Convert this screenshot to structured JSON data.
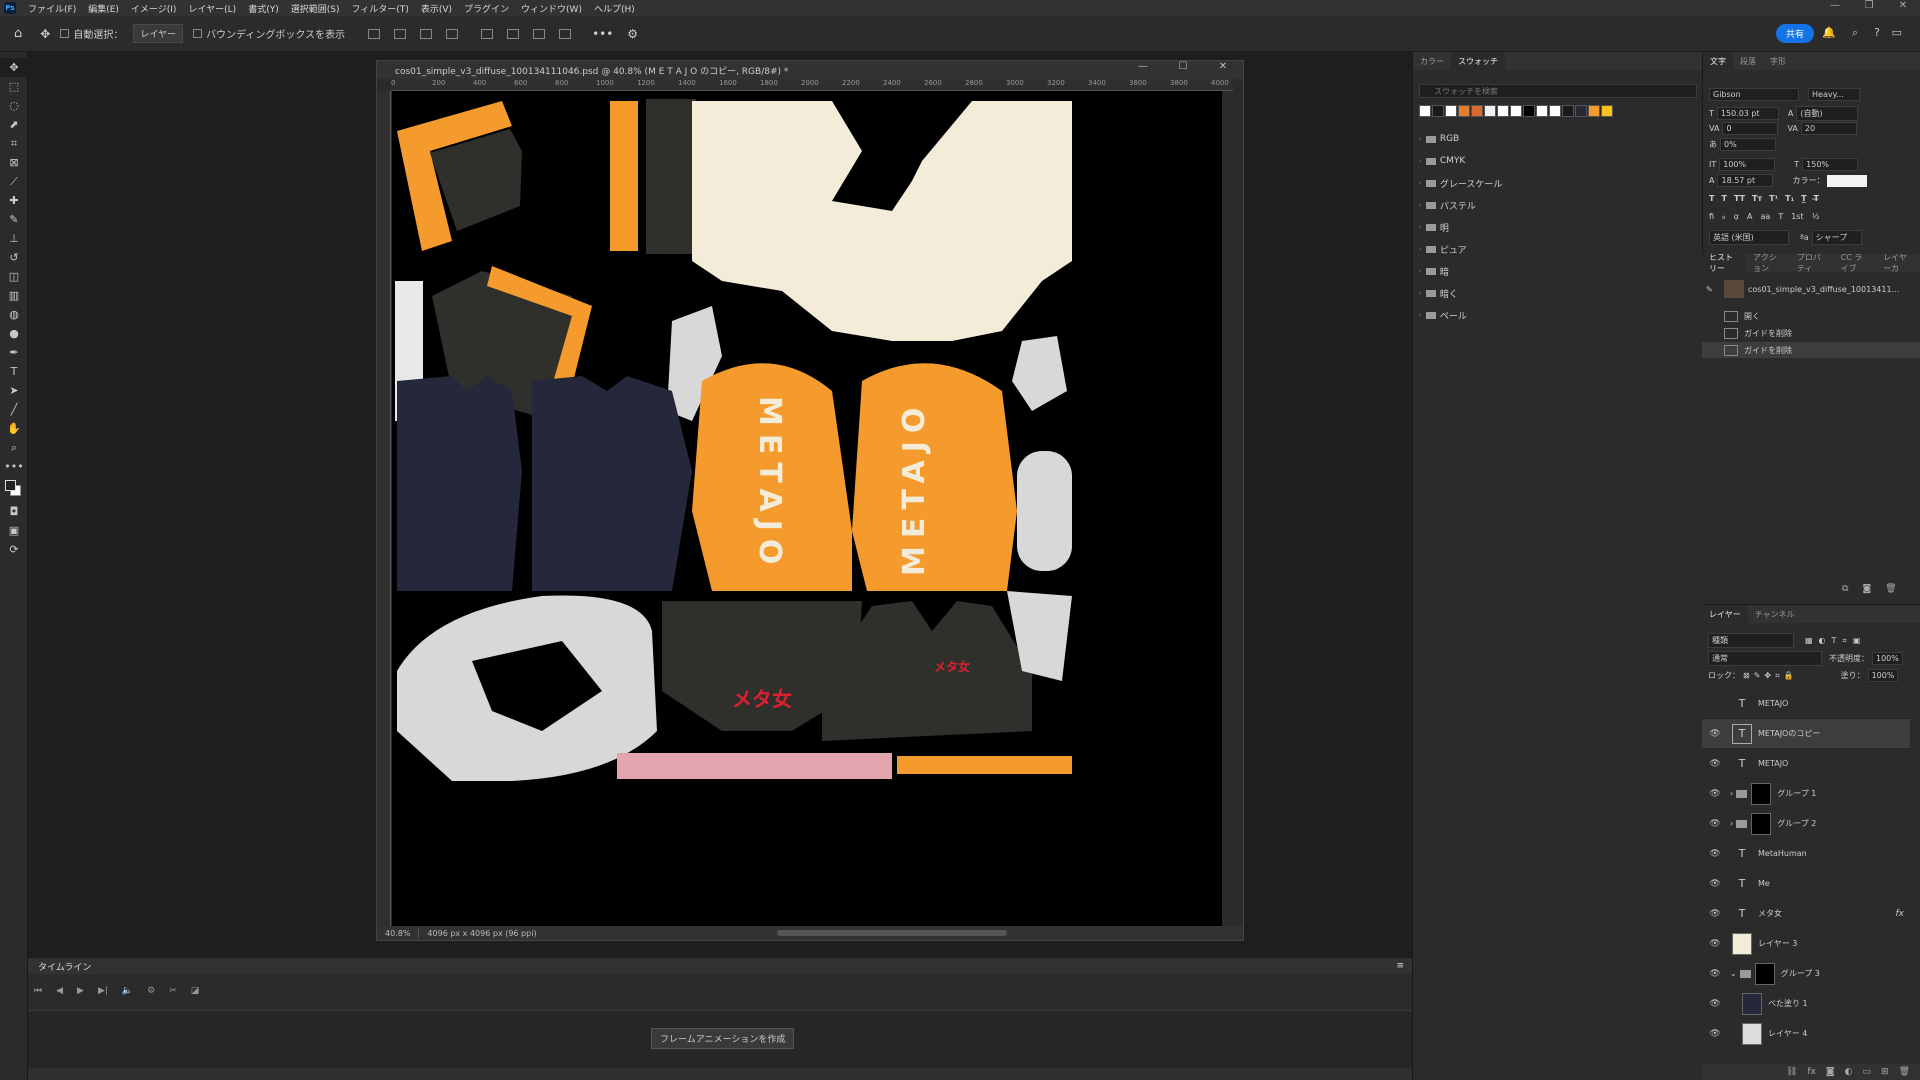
{
  "menubar": {
    "items": [
      "ファイル(F)",
      "編集(E)",
      "イメージ(I)",
      "レイヤー(L)",
      "書式(Y)",
      "選択範囲(S)",
      "フィルター(T)",
      "表示(V)",
      "プラグイン",
      "ウィンドウ(W)",
      "ヘルプ(H)"
    ]
  },
  "options": {
    "auto_select": "自動選択：",
    "auto_select_target": "レイヤー",
    "bounding_box": "バウンディングボックスを表示",
    "share": "共有"
  },
  "document": {
    "title": "cos01_simple_v3_diffuse_100134111046.psd @ 40.8% (M E T A J O のコピー, RGB/8#) *",
    "zoom": "40.8%",
    "dimensions": "4096 px x 4096 px (96 ppi)",
    "ruler_ticks": [
      "0",
      "200",
      "400",
      "600",
      "800",
      "1000",
      "1200",
      "1400",
      "1600",
      "1800",
      "2000",
      "2200",
      "2400",
      "2600",
      "2800",
      "3000",
      "3200",
      "3400",
      "3600",
      "3800",
      "4000"
    ],
    "canvas_texts": {
      "metajo_1": "METAJO",
      "metajo_2": "METAJO",
      "logo_1": "メタ女",
      "logo_2": "メタ女"
    }
  },
  "timeline": {
    "tab": "タイムライン",
    "create_button": "フレームアニメーションを作成"
  },
  "swatches_panel": {
    "tabs": [
      "カラー",
      "スウォッチ"
    ],
    "active_tab": "スウォッチ",
    "search_placeholder": "スウォッチを検索",
    "colors": [
      "#ffffff",
      "#1a1a1a",
      "#ffffff",
      "#e37b2d",
      "#d96a2b",
      "#f0f0f0",
      "#ffffff",
      "#ffffff",
      "#000000",
      "#ffffff",
      "#ffffff",
      "#1a1a1a",
      "#2a2a35",
      "#f59a2d",
      "#ffc21a"
    ],
    "folders": [
      "RGB",
      "CMYK",
      "グレースケール",
      "パステル",
      "明",
      "ピュア",
      "暗",
      "暗く",
      "ペール"
    ]
  },
  "character_panel": {
    "tabs": [
      "文字",
      "段落",
      "字形"
    ],
    "active_tab": "文字",
    "font": "Gibson",
    "style": "Heavy...",
    "size": "150.03 pt",
    "leading": "(自動)",
    "kerning": "0",
    "tracking": "20",
    "scale_pct": "0%",
    "vscale": "100%",
    "hscale": "150%",
    "baseline": "18.57 pt",
    "color_label": "カラー：",
    "language": "英語 (米国)",
    "aa": "シャープ"
  },
  "history_panel": {
    "tabs": [
      "ヒストリー",
      "アクション",
      "プロパティ",
      "CC ライブ",
      "レイヤーカ"
    ],
    "snapshot": "cos01_simple_v3_diffuse_10013411...",
    "items": [
      "開く",
      "ガイドを削除",
      "ガイドを削除"
    ]
  },
  "layers_panel": {
    "tabs": [
      "レイヤー",
      "チャンネル"
    ],
    "kind": "種類",
    "blend": "通常",
    "opacity_label": "不透明度：",
    "opacity": "100%",
    "lock_label": "ロック：",
    "fill_label": "塗り：",
    "fill": "100%",
    "layers": [
      {
        "name": "METAJO",
        "type": "text",
        "visible": false
      },
      {
        "name": "METAJOのコピー",
        "type": "text",
        "visible": true,
        "selected": true
      },
      {
        "name": "METAJO",
        "type": "text",
        "visible": true
      },
      {
        "name": "グループ 1",
        "type": "group",
        "visible": true
      },
      {
        "name": "グループ 2",
        "type": "group",
        "visible": true
      },
      {
        "name": "MetaHuman",
        "type": "text",
        "visible": true
      },
      {
        "name": "Me",
        "type": "text",
        "visible": true
      },
      {
        "name": "メタ女",
        "type": "text",
        "visible": true,
        "fx": "fx"
      },
      {
        "name": "レイヤー 3",
        "type": "pixel",
        "visible": true
      },
      {
        "name": "グループ 3",
        "type": "group",
        "visible": true
      },
      {
        "name": "べた塗り 1",
        "type": "fill",
        "visible": true
      },
      {
        "name": "レイヤー 4",
        "type": "pixel",
        "visible": true
      }
    ]
  }
}
